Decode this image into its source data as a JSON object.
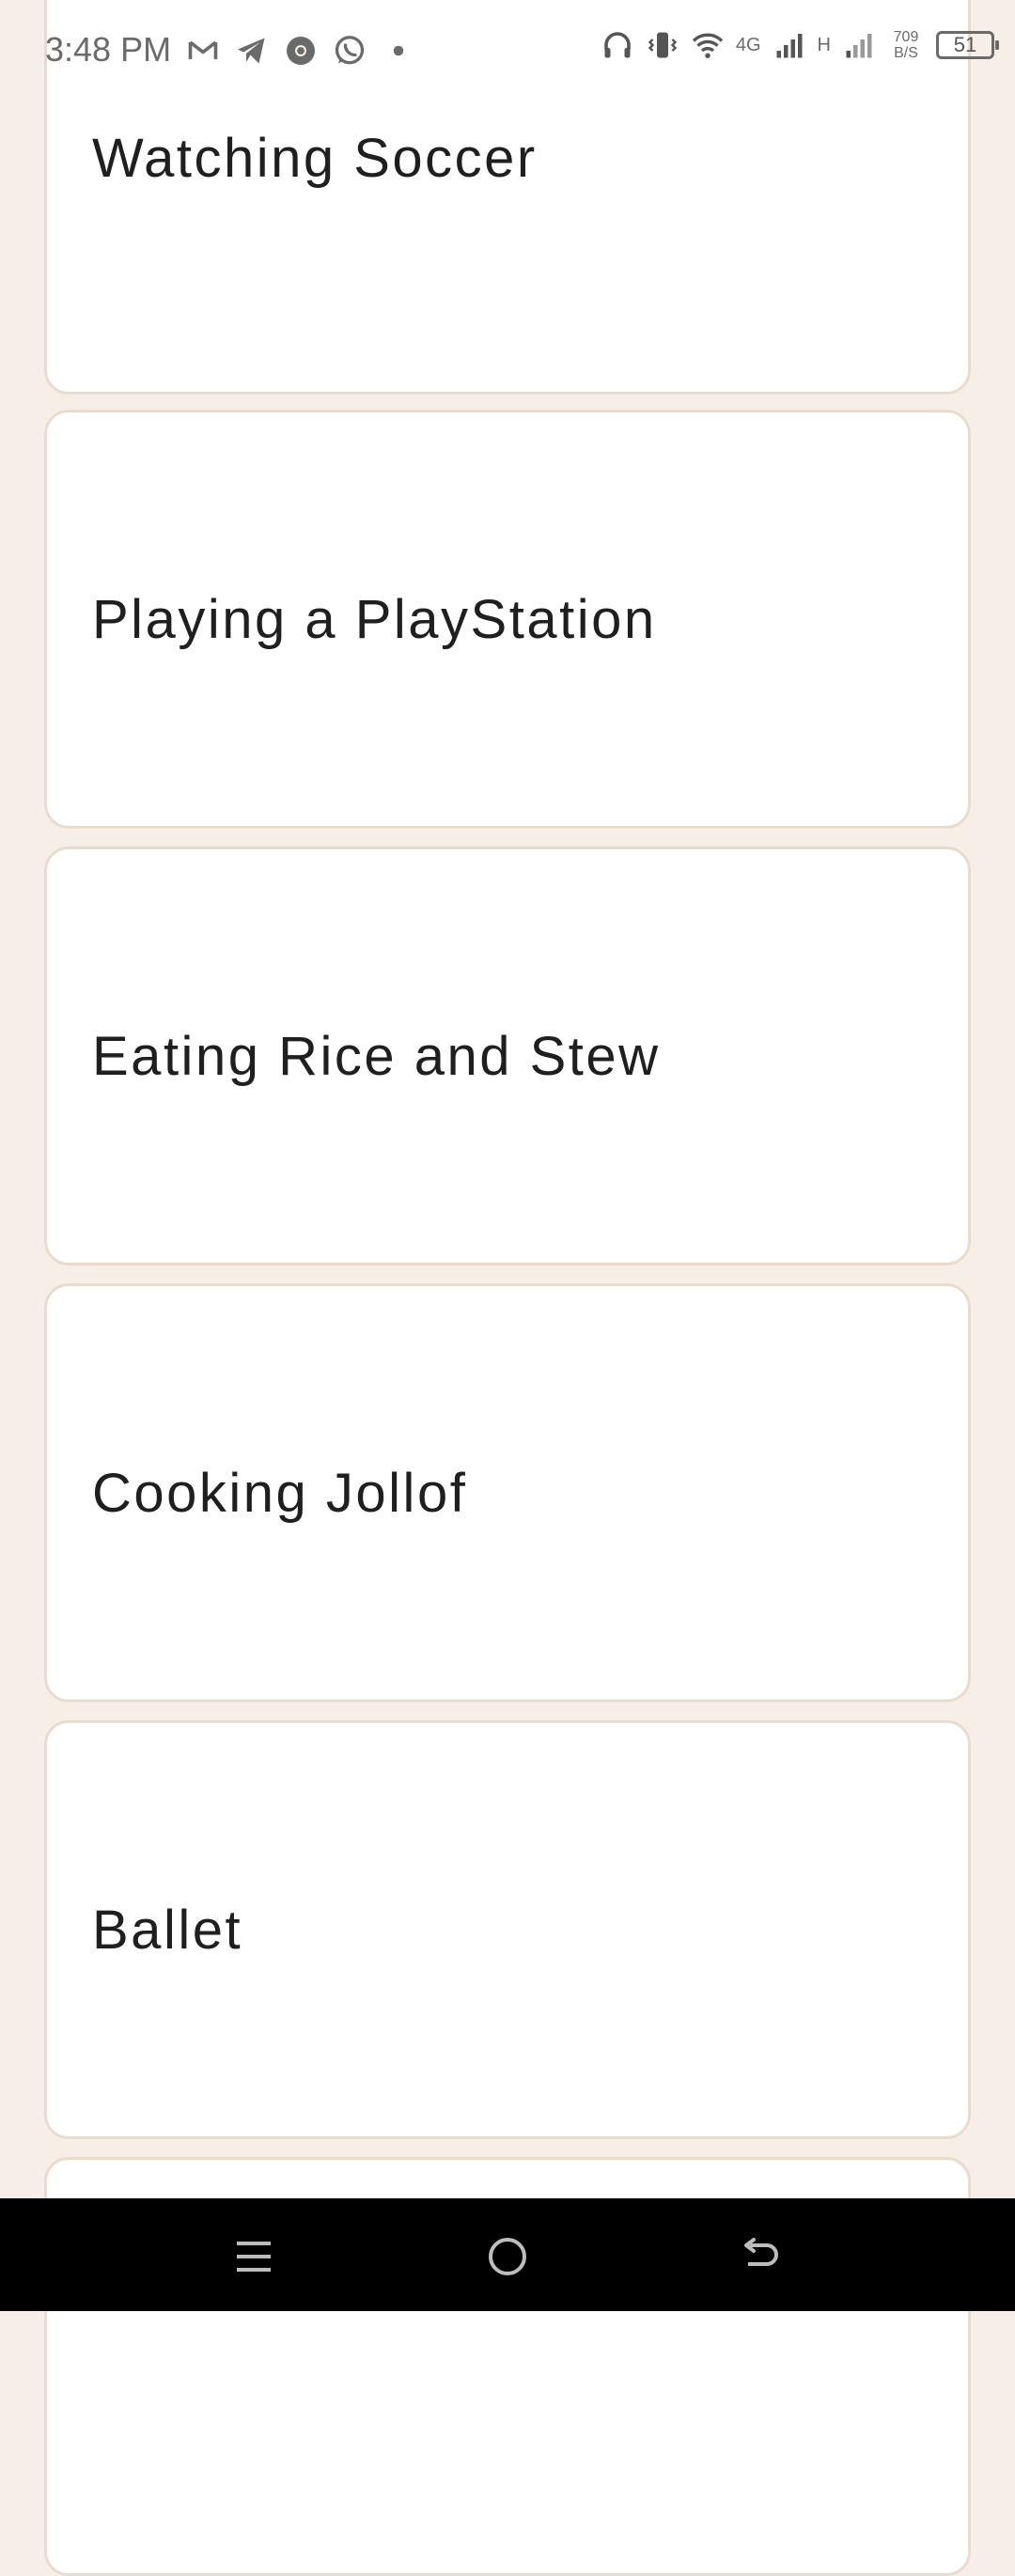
{
  "status_bar": {
    "time": "3:48 PM",
    "network_4g": "4G",
    "network_h": "H",
    "speed_value": "709",
    "speed_unit": "B/S",
    "battery": "51"
  },
  "items": [
    {
      "label": "Watching Soccer"
    },
    {
      "label": "Playing a PlayStation"
    },
    {
      "label": "Eating Rice and Stew"
    },
    {
      "label": "Cooking Jollof"
    },
    {
      "label": "Ballet"
    },
    {
      "label": ""
    }
  ],
  "colors": {
    "background": "#f6efe8",
    "card_border": "#eadccd",
    "card_fill": "#ffffff",
    "text": "#1f1f1f",
    "nav_bar": "#000000"
  },
  "icons": {
    "status_left": [
      "gmail-icon",
      "telegram-icon",
      "chrome-icon",
      "whatsapp-icon",
      "dot-icon"
    ],
    "status_right": [
      "headphones-icon",
      "vibrate-icon",
      "wifi-icon",
      "signal-icon",
      "signal-icon",
      "battery-icon"
    ],
    "nav": [
      "menu-icon",
      "home-icon",
      "back-icon"
    ]
  }
}
